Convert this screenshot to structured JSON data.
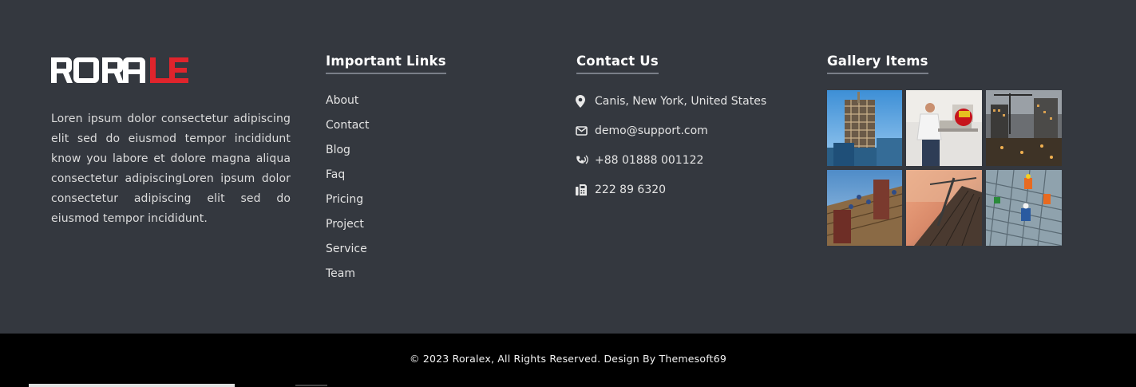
{
  "brand": {
    "logo_text_white": "RORA",
    "logo_text_red": "LEX",
    "colors": {
      "white": "#ffffff",
      "red": "#e0242c"
    }
  },
  "about": {
    "text": "Loren ipsum dolor consectetur adipiscing elit sed do eiusmod tempor incididunt know you labore et dolore magna aliqua consectetur adipiscingLoren ipsum dolor consectetur adipiscing elit sed do eiusmod tempor incididunt."
  },
  "links": {
    "title": "Important Links",
    "items": [
      "About",
      "Contact",
      "Blog",
      "Faq",
      "Pricing",
      "Project",
      "Service",
      "Team"
    ]
  },
  "contact": {
    "title": "Contact Us",
    "items": [
      {
        "icon": "map-marker-icon",
        "text": "Canis, New York, United States"
      },
      {
        "icon": "envelope-icon",
        "text": "demo@support.com"
      },
      {
        "icon": "phone-volume-icon",
        "text": "+88 01888 001122"
      },
      {
        "icon": "fax-icon",
        "text": "222 89 6320"
      }
    ]
  },
  "gallery": {
    "title": "Gallery Items",
    "items": [
      {
        "name": "gallery-image-building-construction"
      },
      {
        "name": "gallery-image-worker-saw"
      },
      {
        "name": "gallery-image-city-night-site"
      },
      {
        "name": "gallery-image-roof-workers"
      },
      {
        "name": "gallery-image-crane-sunset"
      },
      {
        "name": "gallery-image-rebar-workers"
      }
    ]
  },
  "footer_bottom": {
    "copyright": "© 2023 Roralex, All Rights Reserved. Design By Themesoft69"
  }
}
